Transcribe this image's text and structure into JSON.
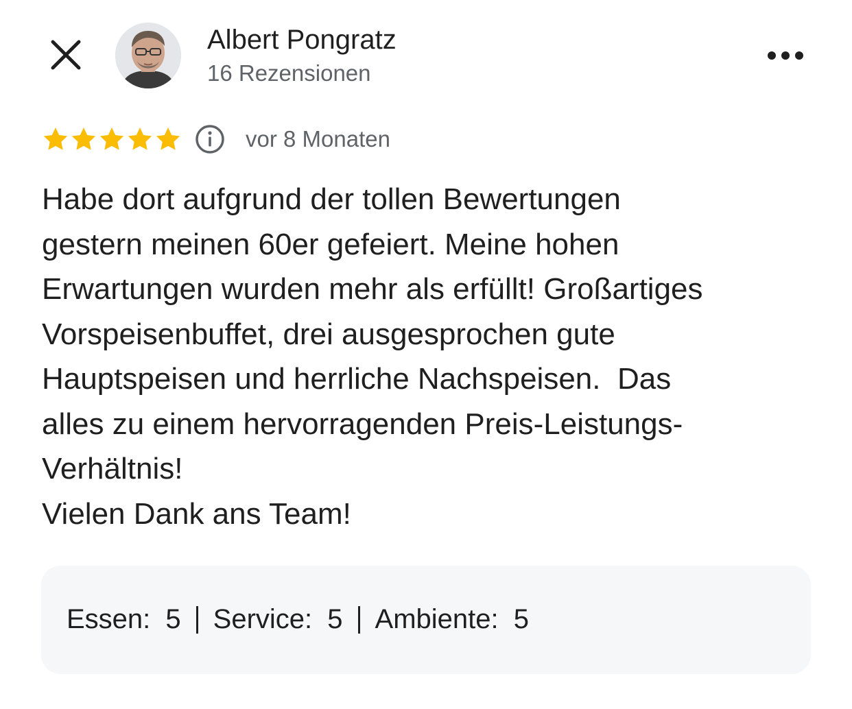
{
  "reviewer": {
    "name": "Albert Pongratz",
    "reviews_count": "16 Rezensionen"
  },
  "icons": {
    "close": "close-icon",
    "more": "more-horizontal-icon",
    "info": "info-icon",
    "star": "star-icon"
  },
  "rating": {
    "stars": 5,
    "max_stars": 5,
    "date": "vor 8 Monaten"
  },
  "review": {
    "lines": [
      "Habe dort aufgrund der tollen Bewertungen",
      "gestern meinen 60er gefeiert. Meine hohen",
      "Erwartungen wurden mehr als erfüllt! Großartiges",
      "Vorspeisenbuffet, drei ausgesprochen gute",
      "Hauptspeisen und herrliche Nachspeisen.  Das",
      "alles zu einem hervorragenden Preis-Leistungs-",
      "Verhältnis!",
      "Vielen Dank ans Team!"
    ]
  },
  "sub_ratings": [
    {
      "label": "Essen:",
      "value": "5"
    },
    {
      "label": "Service:",
      "value": "5"
    },
    {
      "label": "Ambiente:",
      "value": "5"
    }
  ],
  "colors": {
    "star": "#fbbc04",
    "text": "#1f1f1f",
    "secondary_text": "#5f6368",
    "ratings_bg": "#f6f7f9"
  }
}
